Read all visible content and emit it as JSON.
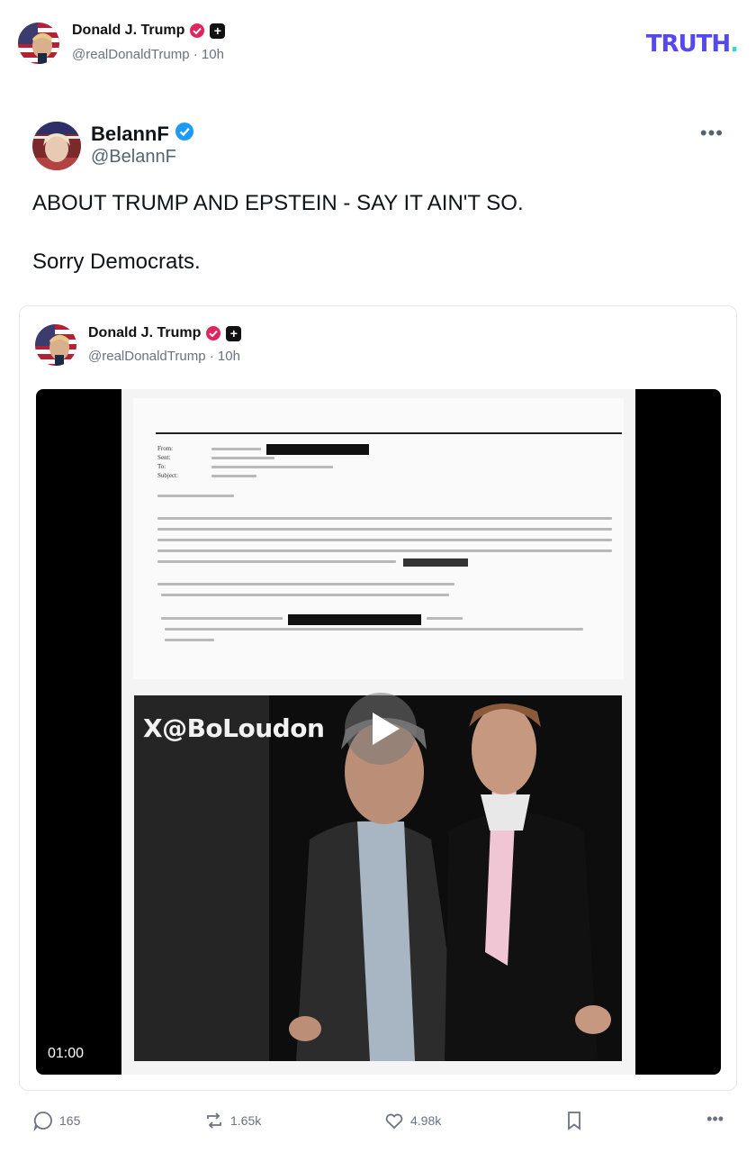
{
  "brand": {
    "logo_text": "TRUTH",
    "logo_dot": ".",
    "color": "#5448ee",
    "dot_color": "#3dd6c3"
  },
  "post": {
    "author_name": "Donald J. Trump",
    "author_handle": "@realDonaldTrump",
    "time": "10h",
    "separator": "·"
  },
  "quoted": {
    "author_name": "BelannF",
    "author_handle": "@BelannF",
    "more_label": "•••",
    "paragraphs": [
      "ABOUT TRUMP AND EPSTEIN - SAY IT AIN'T SO.",
      "Sorry Democrats."
    ]
  },
  "card": {
    "author_name": "Donald J. Trump",
    "author_handle": "@realDonaldTrump",
    "time": "10h",
    "separator": "·",
    "video": {
      "watermark": "X@BoLoudon",
      "duration": "01:00",
      "play_icon": "play-icon"
    }
  },
  "actions": {
    "replies": "165",
    "reposts": "1.65k",
    "likes": "4.98k",
    "more_label": "•••"
  },
  "colors": {
    "verified_pink": "#e0245e",
    "verified_blue": "#1d9bf0",
    "muted": "#6b7280"
  }
}
